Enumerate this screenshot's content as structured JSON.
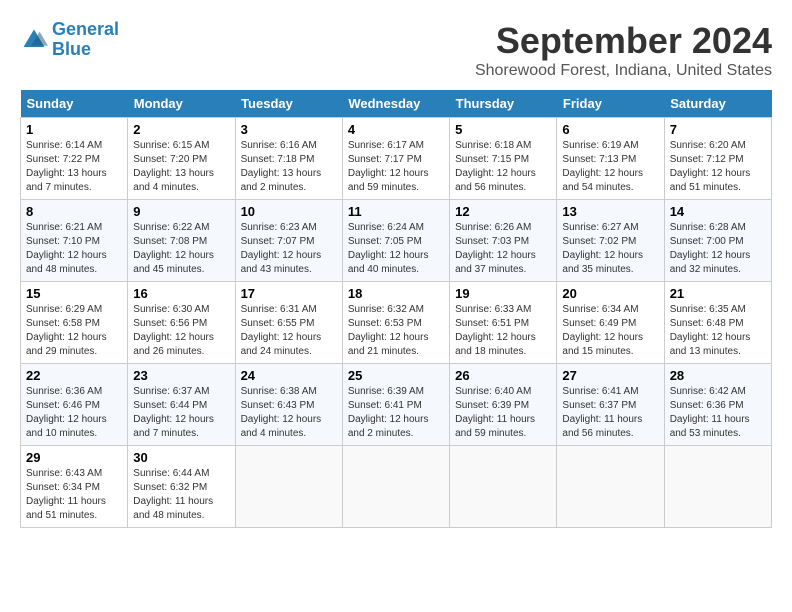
{
  "logo": {
    "line1": "General",
    "line2": "Blue"
  },
  "title": "September 2024",
  "location": "Shorewood Forest, Indiana, United States",
  "days_of_week": [
    "Sunday",
    "Monday",
    "Tuesday",
    "Wednesday",
    "Thursday",
    "Friday",
    "Saturday"
  ],
  "weeks": [
    [
      {
        "day": "1",
        "sunrise": "6:14 AM",
        "sunset": "7:22 PM",
        "daylight": "13 hours and 7 minutes."
      },
      {
        "day": "2",
        "sunrise": "6:15 AM",
        "sunset": "7:20 PM",
        "daylight": "13 hours and 4 minutes."
      },
      {
        "day": "3",
        "sunrise": "6:16 AM",
        "sunset": "7:18 PM",
        "daylight": "13 hours and 2 minutes."
      },
      {
        "day": "4",
        "sunrise": "6:17 AM",
        "sunset": "7:17 PM",
        "daylight": "12 hours and 59 minutes."
      },
      {
        "day": "5",
        "sunrise": "6:18 AM",
        "sunset": "7:15 PM",
        "daylight": "12 hours and 56 minutes."
      },
      {
        "day": "6",
        "sunrise": "6:19 AM",
        "sunset": "7:13 PM",
        "daylight": "12 hours and 54 minutes."
      },
      {
        "day": "7",
        "sunrise": "6:20 AM",
        "sunset": "7:12 PM",
        "daylight": "12 hours and 51 minutes."
      }
    ],
    [
      {
        "day": "8",
        "sunrise": "6:21 AM",
        "sunset": "7:10 PM",
        "daylight": "12 hours and 48 minutes."
      },
      {
        "day": "9",
        "sunrise": "6:22 AM",
        "sunset": "7:08 PM",
        "daylight": "12 hours and 45 minutes."
      },
      {
        "day": "10",
        "sunrise": "6:23 AM",
        "sunset": "7:07 PM",
        "daylight": "12 hours and 43 minutes."
      },
      {
        "day": "11",
        "sunrise": "6:24 AM",
        "sunset": "7:05 PM",
        "daylight": "12 hours and 40 minutes."
      },
      {
        "day": "12",
        "sunrise": "6:26 AM",
        "sunset": "7:03 PM",
        "daylight": "12 hours and 37 minutes."
      },
      {
        "day": "13",
        "sunrise": "6:27 AM",
        "sunset": "7:02 PM",
        "daylight": "12 hours and 35 minutes."
      },
      {
        "day": "14",
        "sunrise": "6:28 AM",
        "sunset": "7:00 PM",
        "daylight": "12 hours and 32 minutes."
      }
    ],
    [
      {
        "day": "15",
        "sunrise": "6:29 AM",
        "sunset": "6:58 PM",
        "daylight": "12 hours and 29 minutes."
      },
      {
        "day": "16",
        "sunrise": "6:30 AM",
        "sunset": "6:56 PM",
        "daylight": "12 hours and 26 minutes."
      },
      {
        "day": "17",
        "sunrise": "6:31 AM",
        "sunset": "6:55 PM",
        "daylight": "12 hours and 24 minutes."
      },
      {
        "day": "18",
        "sunrise": "6:32 AM",
        "sunset": "6:53 PM",
        "daylight": "12 hours and 21 minutes."
      },
      {
        "day": "19",
        "sunrise": "6:33 AM",
        "sunset": "6:51 PM",
        "daylight": "12 hours and 18 minutes."
      },
      {
        "day": "20",
        "sunrise": "6:34 AM",
        "sunset": "6:49 PM",
        "daylight": "12 hours and 15 minutes."
      },
      {
        "day": "21",
        "sunrise": "6:35 AM",
        "sunset": "6:48 PM",
        "daylight": "12 hours and 13 minutes."
      }
    ],
    [
      {
        "day": "22",
        "sunrise": "6:36 AM",
        "sunset": "6:46 PM",
        "daylight": "12 hours and 10 minutes."
      },
      {
        "day": "23",
        "sunrise": "6:37 AM",
        "sunset": "6:44 PM",
        "daylight": "12 hours and 7 minutes."
      },
      {
        "day": "24",
        "sunrise": "6:38 AM",
        "sunset": "6:43 PM",
        "daylight": "12 hours and 4 minutes."
      },
      {
        "day": "25",
        "sunrise": "6:39 AM",
        "sunset": "6:41 PM",
        "daylight": "12 hours and 2 minutes."
      },
      {
        "day": "26",
        "sunrise": "6:40 AM",
        "sunset": "6:39 PM",
        "daylight": "11 hours and 59 minutes."
      },
      {
        "day": "27",
        "sunrise": "6:41 AM",
        "sunset": "6:37 PM",
        "daylight": "11 hours and 56 minutes."
      },
      {
        "day": "28",
        "sunrise": "6:42 AM",
        "sunset": "6:36 PM",
        "daylight": "11 hours and 53 minutes."
      }
    ],
    [
      {
        "day": "29",
        "sunrise": "6:43 AM",
        "sunset": "6:34 PM",
        "daylight": "11 hours and 51 minutes."
      },
      {
        "day": "30",
        "sunrise": "6:44 AM",
        "sunset": "6:32 PM",
        "daylight": "11 hours and 48 minutes."
      },
      null,
      null,
      null,
      null,
      null
    ]
  ]
}
